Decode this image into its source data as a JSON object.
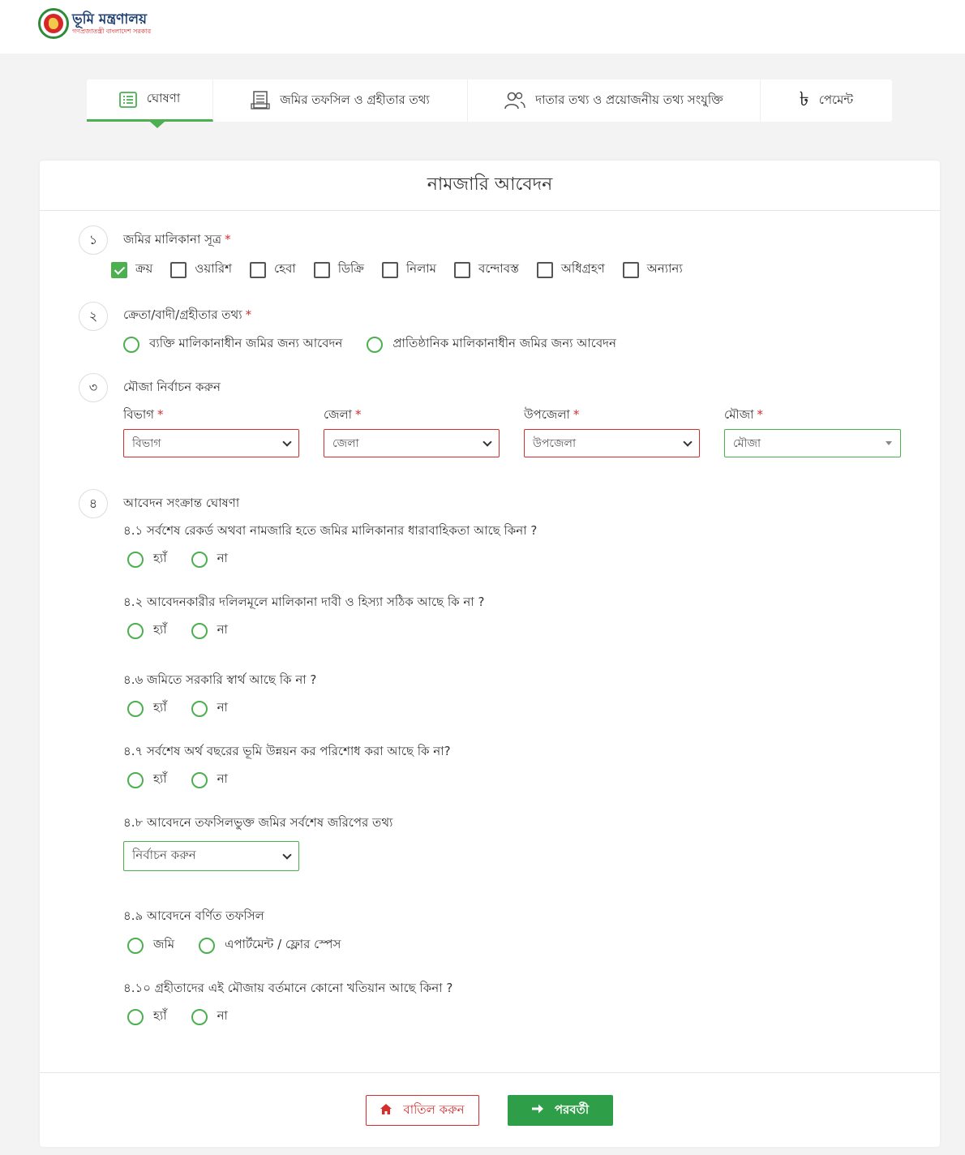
{
  "header": {
    "logo_title": "ভূমি মন্ত্রণালয়",
    "logo_sub": "গণপ্রজাতন্ত্রী বাংলাদেশ সরকার"
  },
  "steps": [
    {
      "label": "ঘোষণা",
      "icon": "list-icon"
    },
    {
      "label": "জমির তফসিল ও গ্রহীতার তথ্য",
      "icon": "document-icon"
    },
    {
      "label": "দাতার তথ্য ও প্রয়োজনীয় তথ্য সংযুক্তি",
      "icon": "users-icon"
    },
    {
      "label": "পেমেন্ট",
      "icon": "taka-icon",
      "icon_glyph": "৳"
    }
  ],
  "form": {
    "title": "নামজারি আবেদন",
    "sections": [
      {
        "number": "১",
        "label": "জমির মালিকানা সূত্র",
        "required_mark": "*"
      },
      {
        "number": "২",
        "label": "ক্রেতা/বাদী/গ্রহীতার তথ্য",
        "required_mark": "*"
      },
      {
        "number": "৩",
        "label": "মৌজা নির্বাচন করুন"
      },
      {
        "number": "৪",
        "label": "আবেদন সংক্রান্ত ঘোষণা"
      }
    ],
    "ownership_options": [
      {
        "label": "ক্রয়",
        "checked": true
      },
      {
        "label": "ওয়ারিশ",
        "checked": false
      },
      {
        "label": "হেবা",
        "checked": false
      },
      {
        "label": "ডিক্রি",
        "checked": false
      },
      {
        "label": "নিলাম",
        "checked": false
      },
      {
        "label": "বন্দোবস্ত",
        "checked": false
      },
      {
        "label": "অধিগ্রহণ",
        "checked": false
      },
      {
        "label": "অন্যান্য",
        "checked": false
      }
    ],
    "applicant_types": [
      "ব্যক্তি মালিকানাধীন জমির জন্য আবেদন",
      "প্রাতিষ্ঠানিক মালিকানাধীন জমির জন্য আবেদন"
    ],
    "location_fields": [
      {
        "label": "বিভাগ",
        "required_mark": "*",
        "placeholder": "বিভাগ"
      },
      {
        "label": "জেলা",
        "required_mark": "*",
        "placeholder": "জেলা"
      },
      {
        "label": "উপজেলা",
        "required_mark": "*",
        "placeholder": "উপজেলা"
      },
      {
        "label": "মৌজা",
        "required_mark": "*",
        "placeholder": "মৌজা"
      }
    ],
    "questions": {
      "q1": {
        "label": "৪.১ সর্বশেষ রেকর্ড অথবা নামজারি হতে জমির মালিকানার ধারাবাহিকতা আছে কিনা ?",
        "yes": "হ্যাঁ",
        "no": "না"
      },
      "q2": {
        "label": "৪.২ আবেদনকারীর দলিলমূলে মালিকানা দাবী ও হিস্যা সঠিক আছে কি না ?",
        "yes": "হ্যাঁ",
        "no": "না"
      },
      "q6": {
        "label": "৪.৬ জমিতে সরকারি স্বার্থ আছে কি না ?",
        "yes": "হ্যাঁ",
        "no": "না"
      },
      "q7": {
        "label": "৪.৭ সর্বশেষ অর্থ বছরের ভূমি উন্নয়ন কর পরিশোধ করা আছে কি না?",
        "yes": "হ্যাঁ",
        "no": "না"
      },
      "q8": {
        "label": "৪.৮ আবেদনে তফসিলভুক্ত জমির সর্বশেষ জরিপের তথ্য",
        "select_placeholder": "নির্বাচন করুন"
      },
      "q9": {
        "label": "৪.৯ আবেদনে বর্ণিত তফসিল",
        "opt1": "জমি",
        "opt2": "এপার্টমেন্ট / ফ্লোর স্পেস"
      },
      "q10": {
        "label": "৪.১০ গ্রহীতাদের এই মৌজায় বর্তমানে কোনো খতিয়ান আছে কিনা ?",
        "yes": "হ্যাঁ",
        "no": "না"
      }
    },
    "buttons": {
      "cancel": "বাতিল করুন",
      "next": "পরবর্তী"
    }
  },
  "colors": {
    "accent": "#4caf50",
    "next_button": "#2e9e48",
    "danger": "#d32f2f"
  }
}
